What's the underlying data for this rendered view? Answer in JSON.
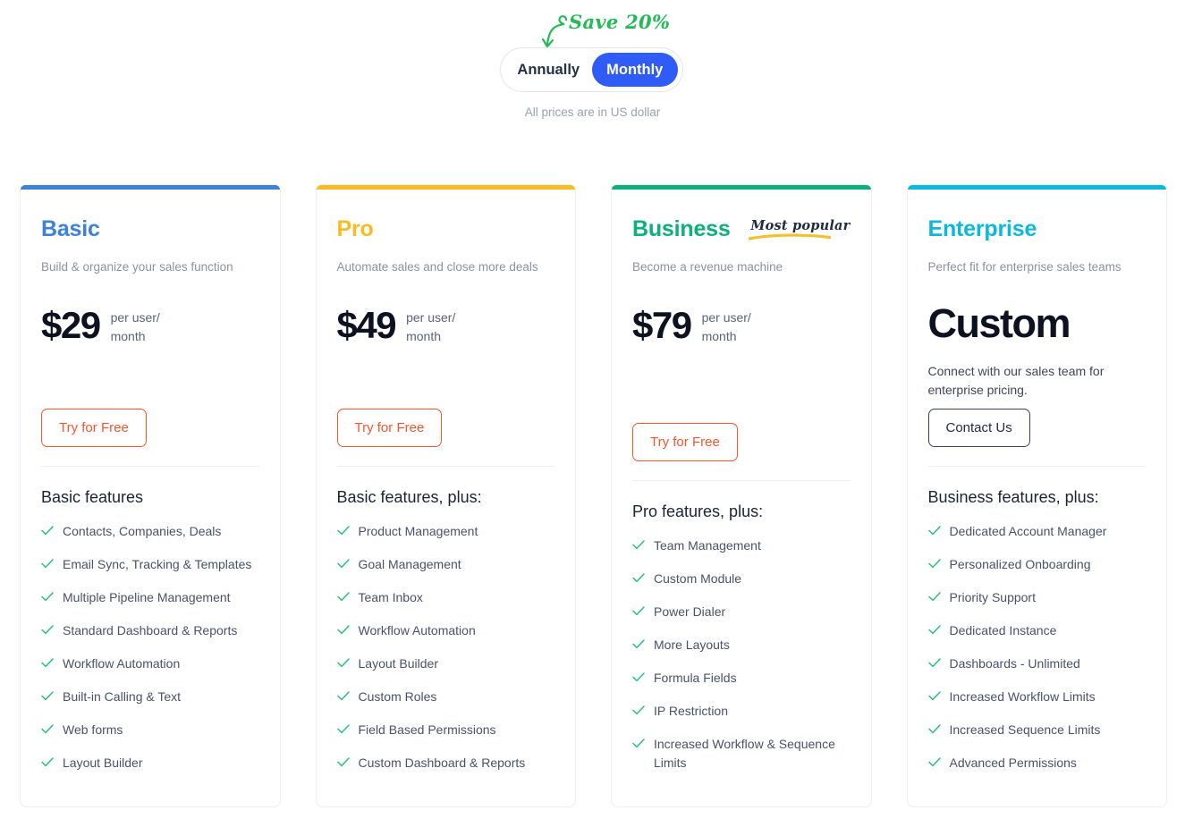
{
  "header": {
    "save_note": "Save 20%",
    "toggle": {
      "options": [
        {
          "label": "Annually",
          "active": false
        },
        {
          "label": "Monthly",
          "active": true
        }
      ]
    },
    "currency_note": "All prices are in US dollar"
  },
  "colors": {
    "basic_accent": "#3b82d8",
    "pro_accent": "#f9bb22",
    "business_accent": "#0bb07b",
    "enterprise_accent": "#0cb8e0",
    "toggle_active": "#2f5bf6",
    "save_note": "#22bb55",
    "cta_try": "#f9552d",
    "cta_contact": "#36405a",
    "check": "#27c07a",
    "badge_underline": "#f4c12a"
  },
  "plans": [
    {
      "name": "Basic",
      "name_color": "#3b82d8",
      "accent": "#3b82d8",
      "tagline": "Build & organize your sales function",
      "price": "$29",
      "price_unit": "per user/\nmonth",
      "cta": "Try for Free",
      "cta_style": "try",
      "badge": null,
      "features_title": "Basic features",
      "features": [
        "Contacts, Companies, Deals",
        "Email Sync, Tracking & Templates",
        "Multiple Pipeline Management",
        "Standard Dashboard & Reports",
        "Workflow Automation",
        "Built-in Calling & Text",
        "Web forms",
        "Layout Builder"
      ]
    },
    {
      "name": "Pro",
      "name_color": "#f9bb22",
      "accent": "#f9bb22",
      "tagline": "Automate sales and close more deals",
      "price": "$49",
      "price_unit": "per user/\nmonth",
      "cta": "Try for Free",
      "cta_style": "try",
      "badge": null,
      "features_title": "Basic features, plus:",
      "features": [
        "Product Management",
        "Goal Management",
        "Team Inbox",
        "Workflow Automation",
        "Layout Builder",
        "Custom Roles",
        "Field Based Permissions",
        "Custom Dashboard & Reports"
      ]
    },
    {
      "name": "Business",
      "name_color": "#0bb07b",
      "accent": "#0bb07b",
      "tagline": "Become a revenue machine",
      "price": "$79",
      "price_unit": "per user/\nmonth",
      "cta": "Try for Free",
      "cta_style": "try",
      "badge": "Most popular",
      "features_title": "Pro features, plus:",
      "features": [
        "Team Management",
        "Custom Module",
        "Power Dialer",
        "More Layouts",
        "Formula Fields",
        "IP Restriction",
        "Increased Workflow & Sequence Limits"
      ]
    },
    {
      "name": "Enterprise",
      "name_color": "#0cb8e0",
      "accent": "#0cb8e0",
      "tagline": "Perfect fit for enterprise sales teams",
      "price": "Custom",
      "price_unit": null,
      "custom_desc": "Connect with our sales team for enterprise pricing.",
      "cta": "Contact Us",
      "cta_style": "contact",
      "badge": null,
      "features_title": "Business features, plus:",
      "features": [
        "Dedicated Account Manager",
        "Personalized Onboarding",
        "Priority Support",
        "Dedicated Instance",
        "Dashboards - Unlimited",
        "Increased Workflow Limits",
        "Increased Sequence Limits",
        "Advanced Permissions"
      ]
    }
  ]
}
